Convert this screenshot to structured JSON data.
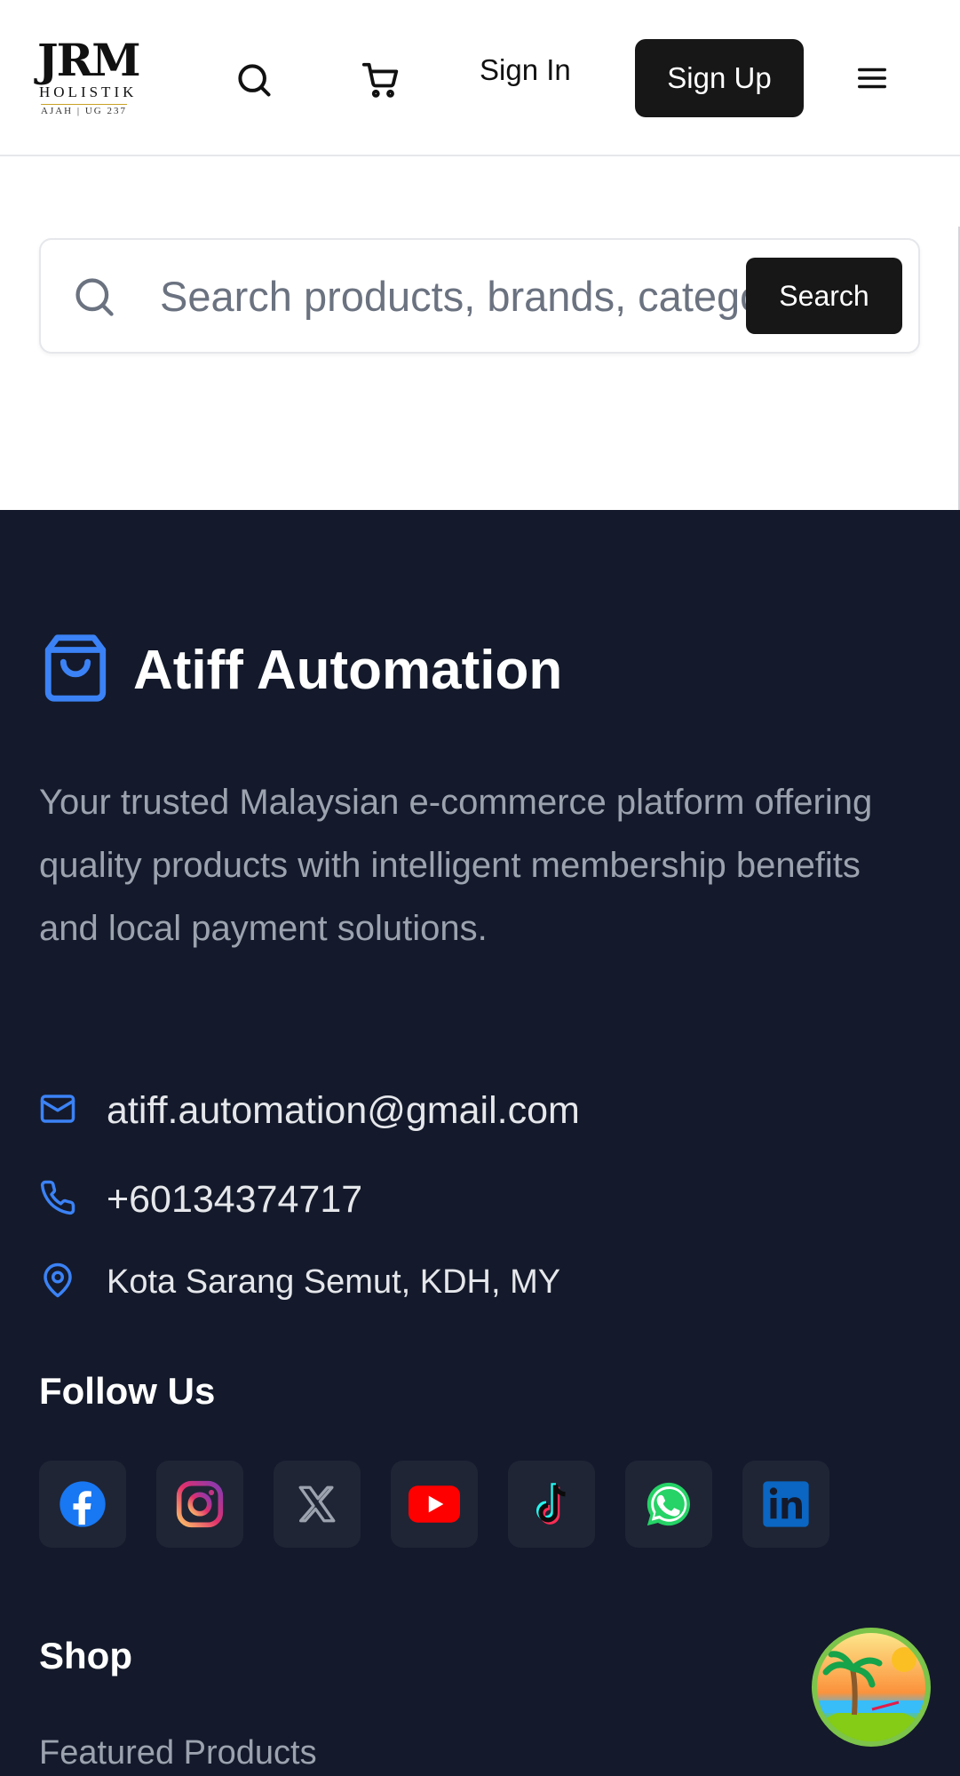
{
  "header": {
    "logo": {
      "mark": "JRM",
      "sub": "HOLISTIK",
      "tag": "AJAH | UG 237"
    },
    "search_icon": "search-icon",
    "cart_icon": "shopping-cart-icon",
    "sign_in_label": "Sign In",
    "sign_up_label": "Sign Up",
    "menu_icon": "hamburger-menu-icon"
  },
  "search": {
    "placeholder": "Search products, brands, categories...",
    "value": "",
    "button_label": "Search"
  },
  "footer": {
    "brand": {
      "icon": "shopping-bag-icon",
      "title": "Atiff Automation",
      "accent": "#3b82f6"
    },
    "description": "Your trusted Malaysian e-commerce platform offering quality products with intelligent membership benefits and local payment solutions.",
    "contacts": {
      "email": "atiff.automation@gmail.com",
      "phone": "+60134374717",
      "location": "Kota Sarang Semut, KDH, MY"
    },
    "follow_heading": "Follow Us",
    "socials": [
      "facebook-icon",
      "instagram-icon",
      "x-icon",
      "youtube-icon",
      "tiktok-icon",
      "whatsapp-icon",
      "linkedin-icon"
    ],
    "shop_heading": "Shop",
    "shop_links": [
      "Featured Products"
    ]
  },
  "colors": {
    "footer_bg": "#141a2b",
    "dark_button": "#171717",
    "accent_blue": "#3b82f6",
    "muted_text": "#9ca3af"
  }
}
